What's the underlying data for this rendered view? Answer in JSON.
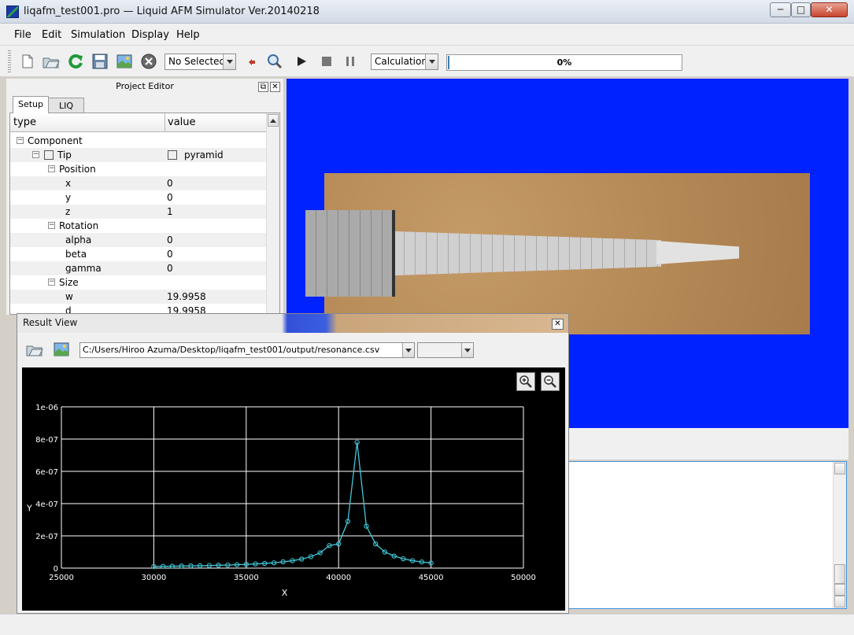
{
  "window": {
    "title": "liqafm_test001.pro — Liquid AFM Simulator Ver.20140218",
    "min_glyph": "─",
    "max_glyph": "□",
    "close_glyph": "✕"
  },
  "menu": [
    "File",
    "Edit",
    "Simulation",
    "Display",
    "Help"
  ],
  "toolbar": {
    "icons": [
      "new-file-icon",
      "open-folder-icon",
      "reload-icon",
      "save-icon",
      "image-icon",
      "stop-circle-icon",
      "undo-icon",
      "zoom-icon",
      "play-icon",
      "stop-icon",
      "pause-icon"
    ],
    "selection_combo": "No Selected",
    "mode_combo": "Calculation",
    "progress": {
      "label": "0%",
      "value": 0
    }
  },
  "project_editor": {
    "title": "Project Editor",
    "float_glyph": "⧉",
    "close_glyph": "✕",
    "tabs": [
      {
        "label": "Setup",
        "active": true
      },
      {
        "label": "LIQ",
        "active": false
      }
    ],
    "columns": [
      "type",
      "value"
    ],
    "rows": [
      {
        "label": "Component",
        "value": "",
        "depth": 0,
        "expander": "⊟"
      },
      {
        "label": "Tip",
        "value": "pyramid",
        "depth": 1,
        "expander": "⊟",
        "icon": true
      },
      {
        "label": "Position",
        "value": "",
        "depth": 2,
        "expander": "⊟"
      },
      {
        "label": "x",
        "value": "0",
        "depth": 3
      },
      {
        "label": "y",
        "value": "0",
        "depth": 3
      },
      {
        "label": "z",
        "value": "1",
        "depth": 3
      },
      {
        "label": "Rotation",
        "value": "",
        "depth": 2,
        "expander": "⊟"
      },
      {
        "label": "alpha",
        "value": "0",
        "depth": 3
      },
      {
        "label": "beta",
        "value": "0",
        "depth": 3
      },
      {
        "label": "gamma",
        "value": "0",
        "depth": 3
      },
      {
        "label": "Size",
        "value": "",
        "depth": 2,
        "expander": "⊟"
      },
      {
        "label": "w",
        "value": "19.9958",
        "depth": 3
      },
      {
        "label": "d",
        "value": "19.9958",
        "depth": 3
      }
    ]
  },
  "result_view": {
    "title": "Result View",
    "close_glyph": "✕",
    "file_path": "C:/Users/Hiroo Azuma/Desktop/liqafm_test001/output/resonance.csv",
    "secondary_combo": ""
  },
  "chart_data": {
    "type": "line",
    "xlabel": "X",
    "ylabel": "Y",
    "xlim": [
      25000,
      50000
    ],
    "ylim": [
      0,
      1e-06
    ],
    "xticks": [
      "25000",
      "30000",
      "35000",
      "40000",
      "45000",
      "50000"
    ],
    "yticks": [
      "0",
      "2e-07",
      "4e-07",
      "6e-07",
      "8e-07",
      "1e-06"
    ],
    "grid": true,
    "colors": {
      "line": "#40c8d8",
      "background": "#000000",
      "grid": "#ffffff"
    },
    "series": [
      {
        "x": [
          30000,
          30500,
          31000,
          31500,
          32000,
          32500,
          33000,
          33500,
          34000,
          34500,
          35000,
          35500,
          36000,
          36500,
          37000,
          37500,
          38000,
          38500,
          39000,
          39500,
          40000,
          40500,
          41000,
          41500,
          42000,
          42500,
          43000,
          43500,
          44000,
          44500,
          45000
        ],
        "y": [
          1e-08,
          1.1e-08,
          1.2e-08,
          1.3e-08,
          1.4e-08,
          1.5e-08,
          1.6e-08,
          1.8e-08,
          1.9e-08,
          2.1e-08,
          2.3e-08,
          2.6e-08,
          2.9e-08,
          3.3e-08,
          3.9e-08,
          4.6e-08,
          5.6e-08,
          7.1e-08,
          9.5e-08,
          1.4e-07,
          1.5e-07,
          2.9e-07,
          7.8e-07,
          2.6e-07,
          1.5e-07,
          1e-07,
          7.5e-08,
          5.8e-08,
          4.6e-08,
          3.8e-08,
          3.2e-08
        ]
      }
    ]
  }
}
